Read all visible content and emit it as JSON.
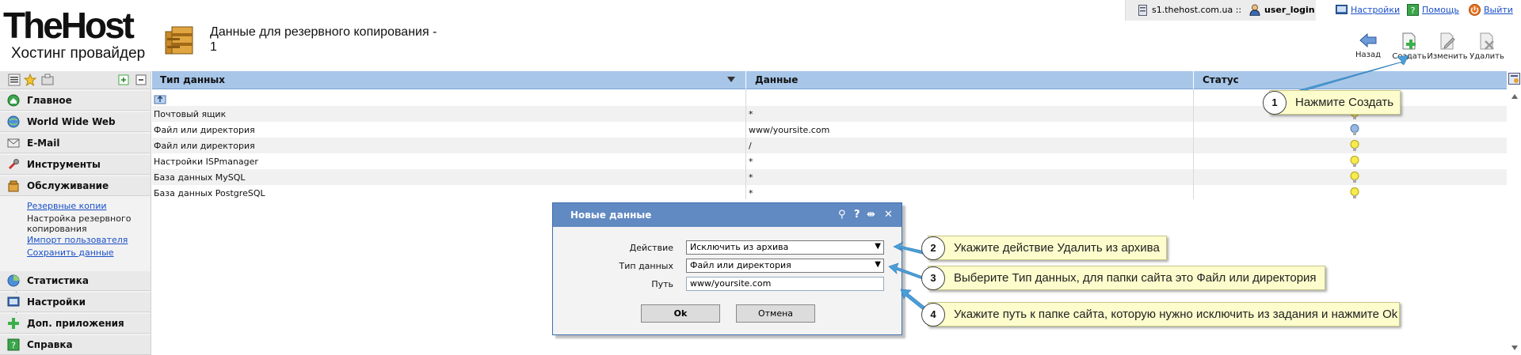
{
  "logo": {
    "line1": "TheHost",
    "line2": "Хостинг провайдер"
  },
  "page": {
    "title_line1": "Данные для резервного копирования -",
    "title_line2": "1"
  },
  "topbar": {
    "server": "s1.thehost.com.ua ::",
    "user": "user_login",
    "settings": "Настройки",
    "help": "Помощь",
    "logout": "Выйти"
  },
  "toolbar": {
    "back": "Назад",
    "create": "Создать",
    "edit": "Изменить",
    "delete": "Удалить"
  },
  "sidebar": {
    "items": [
      {
        "label": "Главное",
        "icon": "home-icon"
      },
      {
        "label": "World Wide Web",
        "icon": "globe-icon"
      },
      {
        "label": "E-Mail",
        "icon": "mail-icon"
      },
      {
        "label": "Инструменты",
        "icon": "tools-icon"
      },
      {
        "label": "Обслуживание",
        "icon": "maintenance-icon"
      },
      {
        "label": "Статистика",
        "icon": "statistics-icon"
      },
      {
        "label": "Настройки",
        "icon": "settings-icon"
      },
      {
        "label": "Доп. приложения",
        "icon": "addons-icon"
      },
      {
        "label": "Справка",
        "icon": "help-icon"
      }
    ],
    "sub": {
      "backups": "Резервные копии",
      "backup_settings": "Настройка резервного копирования",
      "import_user": "Импорт пользователя",
      "save_data": "Сохранить данные"
    }
  },
  "table": {
    "headers": {
      "type": "Тип данных",
      "data": "Данные",
      "status": "Статус"
    },
    "rows": [
      {
        "type": "Почтовый ящик",
        "data": "*"
      },
      {
        "type": "Файл или директория",
        "data": "www/yoursite.com"
      },
      {
        "type": "Файл или директория",
        "data": "/"
      },
      {
        "type": "Настройки ISPmanager",
        "data": "*"
      },
      {
        "type": "База данных MySQL",
        "data": "*"
      },
      {
        "type": "База данных PostgreSQL",
        "data": "*"
      }
    ]
  },
  "dialog": {
    "title": "Новые данные",
    "controls": {
      "pin": "⚲",
      "help": "?",
      "resize": "⇹",
      "close": "✕"
    },
    "action_label": "Действие",
    "action_value": "Исключить из архива",
    "type_label": "Тип данных",
    "type_value": "Файл или директория",
    "path_label": "Путь",
    "path_value": "www/yoursite.com",
    "ok": "Ok",
    "cancel": "Отмена"
  },
  "callouts": [
    {
      "num": "1",
      "text": "Нажмите Создать"
    },
    {
      "num": "2",
      "text": "Укажите действие Удалить из архива"
    },
    {
      "num": "3",
      "text": "Выберите Тип данных, для папки сайта это Файл или директория"
    },
    {
      "num": "4",
      "text": "Укажите путь к папке сайта, которую нужно исключить из задания и нажмите Ok"
    }
  ],
  "colors": {
    "table_header": "#a8c6e8",
    "dialog_title": "#6189c2",
    "callout_bg": "#fcfccc",
    "arrow": "#4a9fd8",
    "link": "#1a50c8"
  }
}
